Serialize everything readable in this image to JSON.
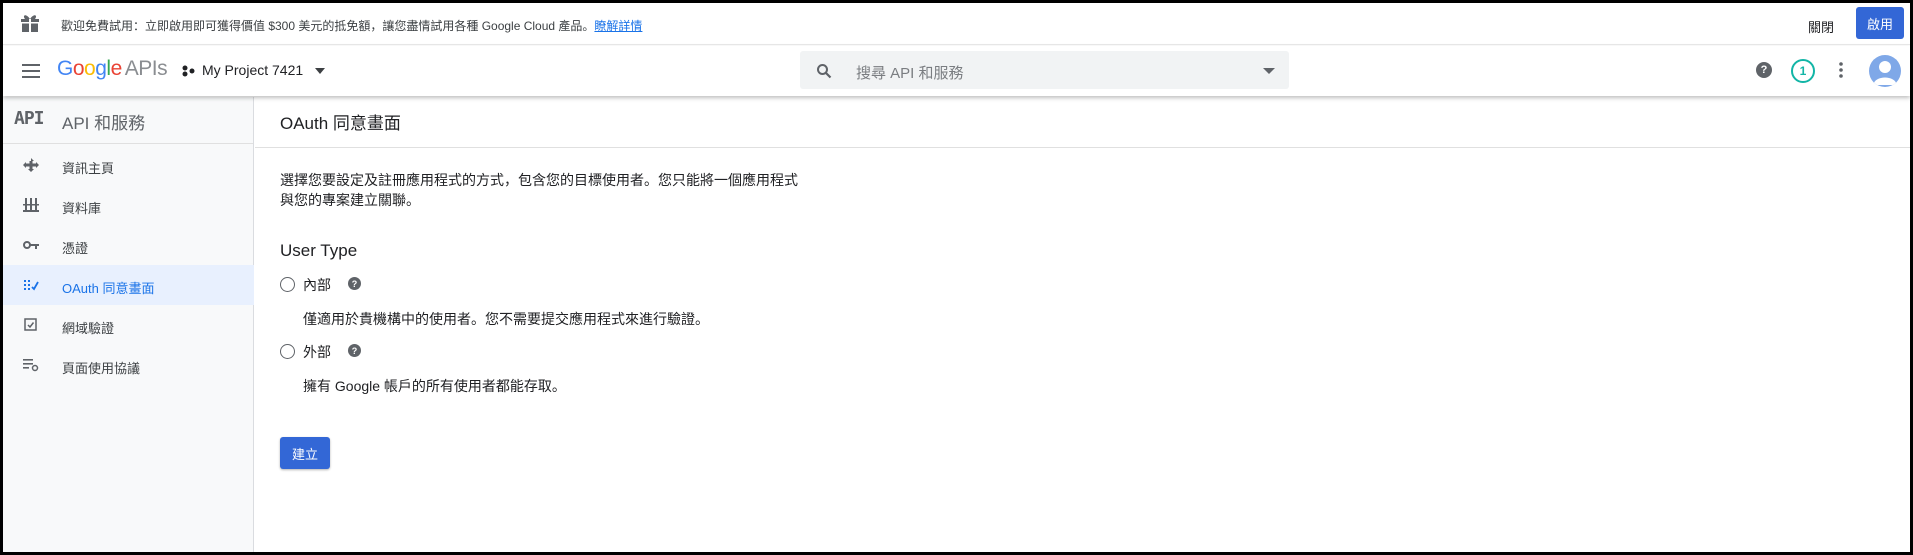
{
  "banner": {
    "message_prefix": "歡迎免費試用：立即啟用即可獲得價值 $300 美元的抵免額，讓您盡情試用各種 Google Cloud 產品。",
    "learn_more": "瞭解詳情",
    "close_label": "關閉",
    "enable_label": "啟用",
    "gift_icon": "gift-icon"
  },
  "header": {
    "logo_google": [
      "G",
      "o",
      "o",
      "g",
      "l",
      "e"
    ],
    "logo_apis": "APIs",
    "project_name": "My Project 7421",
    "search_placeholder": "搜尋 API 和服務",
    "help_glyph": "?",
    "notification_count": "1"
  },
  "colors": {
    "primary": "#3367d6",
    "link": "#1a73e8",
    "active_bg": "#e8f0fe",
    "notification": "#12b5a6",
    "logo": [
      "#4285f4",
      "#ea4335",
      "#fbbc05",
      "#4285f4",
      "#34a853",
      "#ea4335"
    ]
  },
  "sidebar": {
    "logo_text": "API",
    "title": "API 和服務",
    "items": [
      {
        "label": "資訊主頁",
        "icon": "dashboard-icon",
        "active": false
      },
      {
        "label": "資料庫",
        "icon": "library-icon",
        "active": false
      },
      {
        "label": "憑證",
        "icon": "key-icon",
        "active": false
      },
      {
        "label": "OAuth 同意畫面",
        "icon": "oauth-consent-icon",
        "active": true
      },
      {
        "label": "網域驗證",
        "icon": "domain-check-icon",
        "active": false
      },
      {
        "label": "頁面使用協議",
        "icon": "settings-list-icon",
        "active": false
      }
    ]
  },
  "main": {
    "title": "OAuth 同意畫面",
    "description": "選擇您要設定及註冊應用程式的方式，包含您的目標使用者。您只能將一個應用程式與您的專案建立關聯。",
    "user_type_heading": "User Type",
    "options": [
      {
        "label": "內部",
        "description": "僅適用於貴機構中的使用者。您不需要提交應用程式來進行驗證。",
        "selected": false
      },
      {
        "label": "外部",
        "description": "擁有 Google 帳戶的所有使用者都能存取。",
        "selected": false
      }
    ],
    "create_label": "建立"
  }
}
